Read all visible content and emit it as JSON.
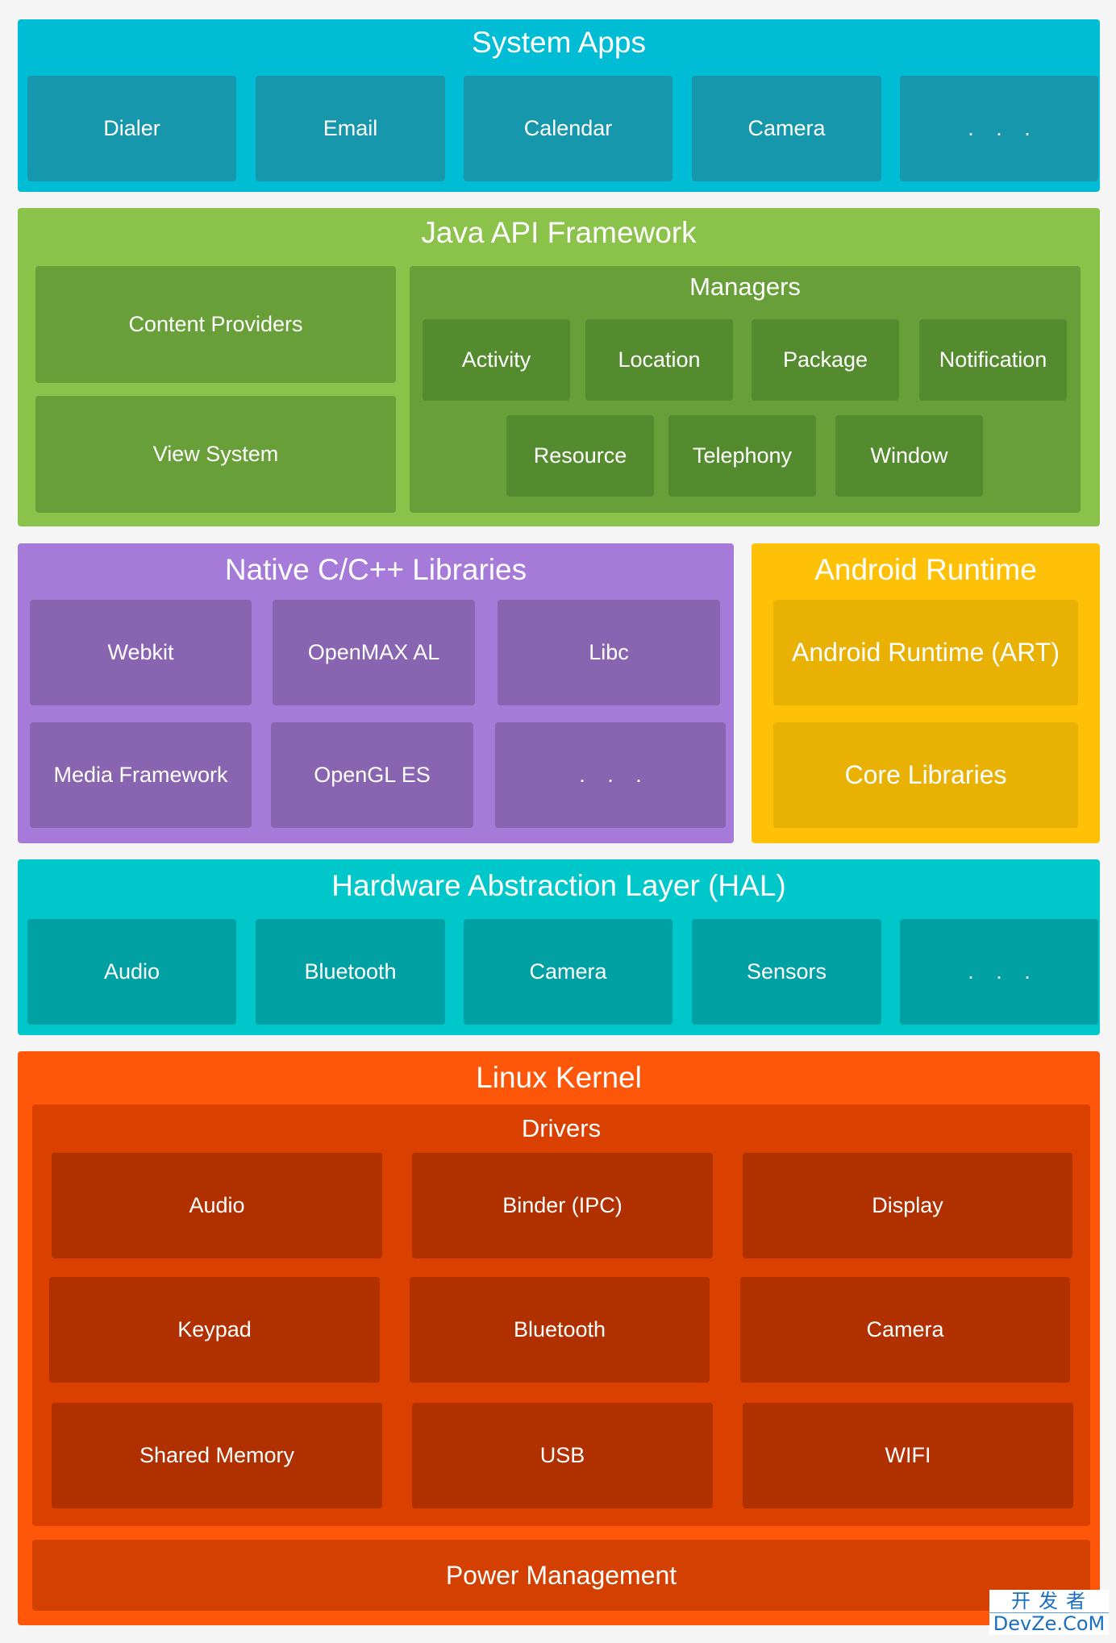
{
  "layers": {
    "system_apps": {
      "title": "System Apps",
      "items": [
        "Dialer",
        "Email",
        "Calendar",
        "Camera",
        ". . ."
      ]
    },
    "java_api": {
      "title": "Java API Framework",
      "left_items": [
        "Content Providers",
        "View System"
      ],
      "managers": {
        "title": "Managers",
        "row1": [
          "Activity",
          "Location",
          "Package",
          "Notification"
        ],
        "row2": [
          "Resource",
          "Telephony",
          "Window"
        ]
      }
    },
    "native_libs": {
      "title": "Native C/C++ Libraries",
      "row1": [
        "Webkit",
        "OpenMAX AL",
        "Libc"
      ],
      "row2": [
        "Media Framework",
        "OpenGL ES",
        ". . ."
      ]
    },
    "android_runtime": {
      "title": "Android Runtime",
      "items": [
        "Android Runtime (ART)",
        "Core Libraries"
      ]
    },
    "hal": {
      "title": "Hardware Abstraction Layer (HAL)",
      "items": [
        "Audio",
        "Bluetooth",
        "Camera",
        "Sensors",
        ". . ."
      ]
    },
    "linux_kernel": {
      "title": "Linux Kernel",
      "drivers": {
        "title": "Drivers",
        "row1": [
          "Audio",
          "Binder (IPC)",
          "Display"
        ],
        "row2": [
          "Keypad",
          "Bluetooth",
          "Camera"
        ],
        "row3": [
          "Shared Memory",
          "USB",
          "WIFI"
        ]
      },
      "power_management": "Power Management"
    }
  },
  "watermark": {
    "line1": "开发者",
    "line2": "DevZe.CoM"
  },
  "colors": {
    "system_apps": "#00bcd4",
    "java_api": "#8bc34a",
    "native_libs": "#a67ad9",
    "android_runtime": "#ffc107",
    "hal": "#00c7ca",
    "linux_kernel": "#ff570a"
  }
}
